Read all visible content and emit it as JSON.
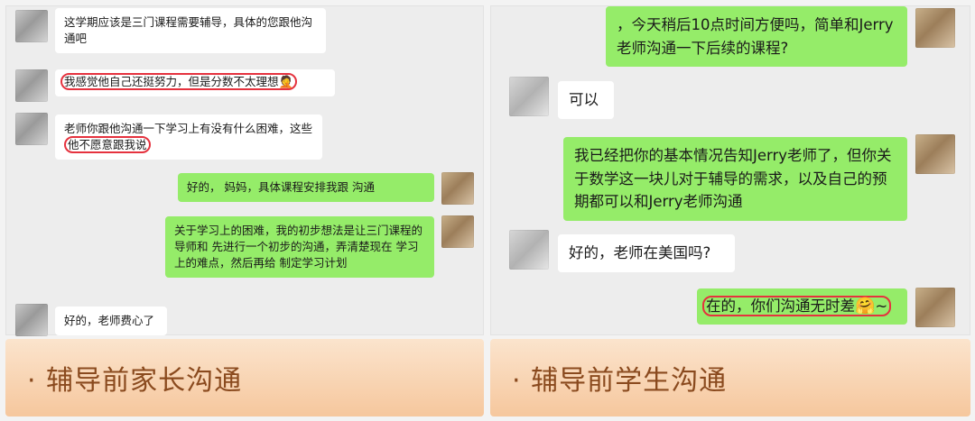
{
  "left": {
    "messages": [
      {
        "text": "这学期应该是三门课程需要辅导，具体的您跟他沟通吧"
      },
      {
        "text": "我感觉他自己还挺努力，但是分数不太理想",
        "emoji": "🤦"
      },
      {
        "text_a": "老师你跟他沟通一下学习上有没有什么困难，这",
        "text_b": "些",
        "text_hl": "他不愿意跟我说"
      },
      {
        "text": "好的，      妈妈，具体课程安排我跟      沟通"
      },
      {
        "text": "关于学习上的困难，我的初步想法是让三门课程的导师和      先进行一个初步的沟通，弄清楚现在      学习上的难点，然后再给      制定学习计划"
      },
      {
        "text": "好的，老师费心了"
      }
    ],
    "footer": "· 辅导前家长沟通"
  },
  "right": {
    "messages": [
      {
        "text": "     ，今天稍后10点时间方便吗，简单和Jerry老师沟通一下后续的课程?"
      },
      {
        "text": "可以"
      },
      {
        "text": "我已经把你的基本情况告知Jerry老师了，但你关于数学这一块儿对于辅导的需求，以及自己的预期都可以和Jerry老师沟通"
      },
      {
        "text": "好的，老师在美国吗?"
      },
      {
        "text": "在的，你们沟通无时差",
        "emoji": "🤗",
        "tail": "~"
      }
    ],
    "footer": "· 辅导前学生沟通"
  }
}
